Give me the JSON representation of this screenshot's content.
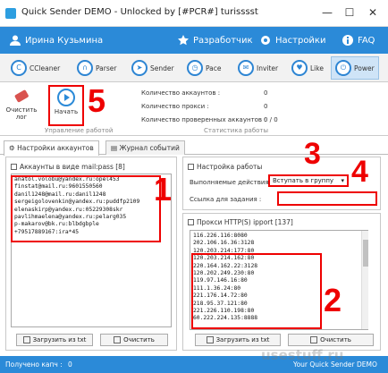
{
  "window": {
    "title": "Quick Sender DEMO -  Unlocked by [#PCR#] turisssst",
    "minimize": "—",
    "maximize": "☐",
    "close": "✕"
  },
  "topbar": {
    "user_name": "Ирина Кузьмина",
    "developer": "Разработчик",
    "settings": "Настройки",
    "faq": "FAQ"
  },
  "modules": [
    "CCleaner",
    "Parser",
    "Sender",
    "Pace",
    "Inviter",
    "Like",
    "Power"
  ],
  "ribbon": {
    "clear_log": "Очистить лог",
    "start": "Начать",
    "group_manage": "Управление работой",
    "group_stats": "Статистика работы",
    "stats": [
      {
        "label": "Количество аккаунтов :",
        "value": "0"
      },
      {
        "label": "Количество прокси :",
        "value": "0"
      },
      {
        "label": "Количество проверенных аккаунтов :",
        "value": "0 / 0"
      }
    ]
  },
  "tabs": {
    "account_settings": "Настройки аккаунтов",
    "event_log": "Журнал событий"
  },
  "accounts_panel": {
    "title": "Аккаунты в виде mail:pass [8]",
    "lines": [
      "anatol.volobu@yandex.ru:opel453",
      "finstat@mail.ru:9601550560",
      "danil1248@mail.ru:danil1248",
      "sergeigolovenkin@yandex.ru:puddfp2109",
      "elenaskirp@yandex.ru:05229308skr",
      "pavlihmaelena@yandex.ru:pelarg035",
      "p-makarov@bk.ru:blbdgbple",
      "+79517889167:ira*45"
    ],
    "load_button": "Загрузить из txt",
    "clear_button": "Очистить"
  },
  "work_settings": {
    "title": "Настройка работы",
    "action_label": "Выполняемые действия :",
    "action_value": "Вступать в группу",
    "link_label": "Ссылка для задания :",
    "link_value": ""
  },
  "proxy_panel": {
    "title": "Прокси HTTP(S) ipport [137]",
    "lines": [
      "116.226.116:8080",
      "202.106.16.36:3128",
      "120.203.214:177:80",
      "120.203.214.162:80",
      "220.164.162.22:3128",
      "120.202.249.230:80",
      "119.97.146.16:80",
      "111.1.36.24:80",
      "221.176.14.72:80",
      "218.95.37.121:80",
      "221.226.110.198:80",
      "60.222.224.135:8888"
    ],
    "load_button": "Загрузить из txt",
    "clear_button": "Очистить"
  },
  "annotations": [
    "1",
    "2",
    "3",
    "4",
    "5"
  ],
  "statusbar": {
    "received_label": "Получено капч :",
    "received_value": "0",
    "version": "Your Quick Sender DEMO",
    "watermark": "usestuff.ru"
  },
  "colors": {
    "brand": "#2b8ad8",
    "annotation": "#e00000"
  }
}
